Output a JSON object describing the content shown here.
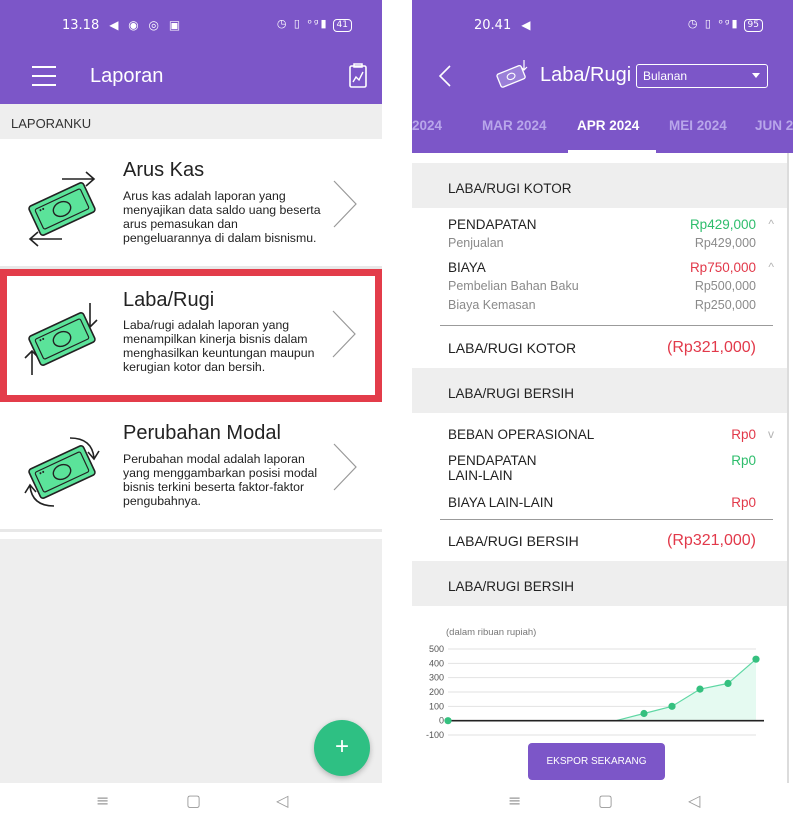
{
  "left": {
    "status": {
      "time": "13.18",
      "icons": "◀ ◉ ◎ ▣",
      "right_icons": "◷ ▯ ᵒᵍ▮",
      "battery": "41"
    },
    "appbar": {
      "title": "Laporan"
    },
    "section_label": "LAPORANKU",
    "reports": [
      {
        "title": "Arus Kas",
        "description": "Arus kas adalah laporan yang menyajikan data saldo uang beserta arus pemasukan dan pengeluarannya di dalam bisnismu."
      },
      {
        "title": "Laba/Rugi",
        "description": "Laba/rugi adalah laporan yang menampilkan kinerja bisnis dalam menghasilkan keuntungan maupun kerugian kotor dan bersih."
      },
      {
        "title": "Perubahan Modal",
        "description": "Perubahan modal adalah laporan yang menggambarkan posisi modal bisnis terkini beserta faktor-faktor pengubahnya."
      }
    ],
    "fab_label": "+",
    "navbar": {
      "menu": "≡",
      "home": "▢",
      "back": "◁"
    }
  },
  "right": {
    "status": {
      "time": "20.41",
      "icons": "◀",
      "right_icons": "◷ ▯ ᵒᵍ▮",
      "battery": "95"
    },
    "appbar": {
      "title": "Laba/Rugi",
      "period_select": "Bulanan"
    },
    "tabs": [
      "2024",
      "MAR 2024",
      "APR 2024",
      "MEI 2024",
      "JUN 2"
    ],
    "active_tab": "APR 2024",
    "gross": {
      "header": "LABA/RUGI KOTOR",
      "pendapatan": {
        "label": "PENDAPATAN",
        "amount": "Rp429,000"
      },
      "penjualan": {
        "label": "Penjualan",
        "amount": "Rp429,000"
      },
      "biaya": {
        "label": "BIAYA",
        "amount": "Rp750,000"
      },
      "bahan_baku": {
        "label": "Pembelian Bahan Baku",
        "amount": "Rp500,000"
      },
      "kemasan": {
        "label": "Biaya Kemasan",
        "amount": "Rp250,000"
      },
      "total": {
        "label": "LABA/RUGI KOTOR",
        "amount": "(Rp321,000)"
      }
    },
    "net": {
      "header": "LABA/RUGI BERSIH",
      "beban": {
        "label": "BEBAN OPERASIONAL",
        "amount": "Rp0"
      },
      "pendapatan_lain": {
        "label_line1": "PENDAPATAN",
        "label_line2": "LAIN-LAIN",
        "amount": "Rp0"
      },
      "biaya_lain": {
        "label": "BIAYA LAIN-LAIN",
        "amount": "Rp0"
      },
      "total": {
        "label": "LABA/RUGI BERSIH",
        "amount": "(Rp321,000)"
      }
    },
    "chart_header": "LABA/RUGI BERSIH",
    "chart_caption": "(dalam ribuan rupiah)",
    "export_label": "EKSPOR SEKARANG",
    "navbar": {
      "menu": "≡",
      "home": "▢",
      "back": "◁"
    },
    "chevron_up": "^",
    "chevron_down": "v"
  },
  "chart_data": {
    "type": "area",
    "title": "",
    "xlabel": "",
    "ylabel": "(dalam ribuan rupiah)",
    "y_ticks": [
      "500",
      "400",
      "300",
      "200",
      "100",
      "0",
      "-100"
    ],
    "ylim": [
      -100,
      500
    ],
    "x": [
      1,
      2,
      3,
      4,
      5,
      6,
      7,
      8,
      9,
      10,
      11,
      12
    ],
    "series": [
      {
        "values": [
          0,
          0,
          0,
          0,
          0,
          0,
          0,
          50,
          100,
          220,
          260,
          429
        ]
      }
    ],
    "grid": true,
    "colors": {
      "line": "#5fd7a4",
      "fill": "#e5faf1",
      "point": "#35c07f"
    }
  },
  "colors": {
    "primary": "#7c56c8",
    "accent_green": "#2ec083",
    "negative_red": "#e2394a",
    "highlight_border": "#e33c4a"
  }
}
